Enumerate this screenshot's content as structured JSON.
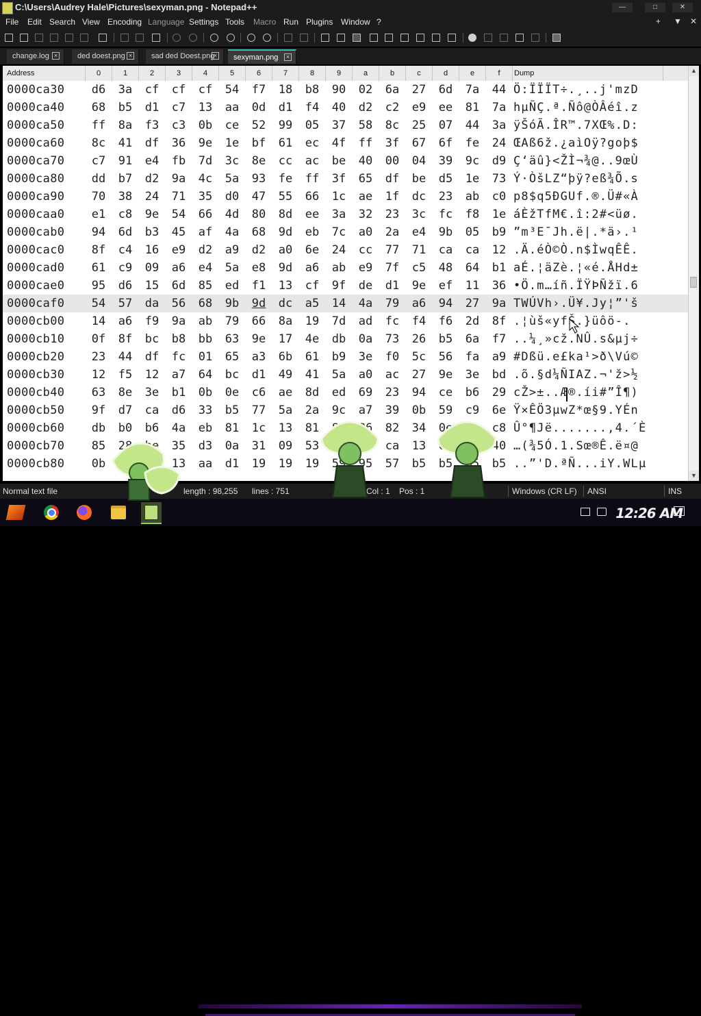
{
  "window": {
    "title": "C:\\Users\\Audrey Hale\\Pictures\\sexyman.png - Notepad++",
    "controls": [
      "—",
      "□",
      "✕"
    ]
  },
  "menu": {
    "items": [
      "File",
      "Edit",
      "Search",
      "View",
      "Encoding",
      "Language",
      "Settings",
      "Tools",
      "Macro",
      "Run",
      "Plugins",
      "Window",
      "?"
    ],
    "right_controls": [
      "+",
      "▼",
      "✕"
    ]
  },
  "tabs": [
    {
      "label": "change.log",
      "active": false
    },
    {
      "label": "ded doest.png",
      "active": false
    },
    {
      "label": "sad ded Doest.png",
      "active": false
    },
    {
      "label": "sexyman.png",
      "active": true
    }
  ],
  "hex_header": {
    "address": "Address",
    "columns": [
      "0",
      "1",
      "2",
      "3",
      "4",
      "5",
      "6",
      "7",
      "8",
      "9",
      "a",
      "b",
      "c",
      "d",
      "e",
      "f"
    ],
    "dump": "Dump"
  },
  "hex_rows": [
    {
      "addr": "0000ca30",
      "bytes": [
        "d6",
        "3a",
        "cf",
        "cf",
        "cf",
        "54",
        "f7",
        "18",
        "b8",
        "90",
        "02",
        "6a",
        "27",
        "6d",
        "7a",
        "44"
      ],
      "dump": "Ö:ÏÏÏT÷.¸..j'mzD"
    },
    {
      "addr": "0000ca40",
      "bytes": [
        "68",
        "b5",
        "d1",
        "c7",
        "13",
        "aa",
        "0d",
        "d1",
        "f4",
        "40",
        "d2",
        "c2",
        "e9",
        "ee",
        "81",
        "7a"
      ],
      "dump": "hµÑÇ.ª.Ñô@ÒÂéî.z"
    },
    {
      "addr": "0000ca50",
      "bytes": [
        "ff",
        "8a",
        "f3",
        "c3",
        "0b",
        "ce",
        "52",
        "99",
        "05",
        "37",
        "58",
        "8c",
        "25",
        "07",
        "44",
        "3a"
      ],
      "dump": "ÿŠóÃ.ÎR™.7XŒ%.D:"
    },
    {
      "addr": "0000ca60",
      "bytes": [
        "8c",
        "41",
        "df",
        "36",
        "9e",
        "1e",
        "bf",
        "61",
        "ec",
        "4f",
        "ff",
        "3f",
        "67",
        "6f",
        "fe",
        "24"
      ],
      "dump": "ŒAß6ž.¿aìOÿ?goþ$"
    },
    {
      "addr": "0000ca70",
      "bytes": [
        "c7",
        "91",
        "e4",
        "fb",
        "7d",
        "3c",
        "8e",
        "cc",
        "ac",
        "be",
        "40",
        "00",
        "04",
        "39",
        "9c",
        "d9"
      ],
      "dump": "Ç‘äû}<ŽÌ¬¾@..9œÙ"
    },
    {
      "addr": "0000ca80",
      "bytes": [
        "dd",
        "b7",
        "d2",
        "9a",
        "4c",
        "5a",
        "93",
        "fe",
        "ff",
        "3f",
        "65",
        "df",
        "be",
        "d5",
        "1e",
        "73"
      ],
      "dump": "Ý·ÒšLZ“þÿ?eß¾Õ.s"
    },
    {
      "addr": "0000ca90",
      "bytes": [
        "70",
        "38",
        "24",
        "71",
        "35",
        "d0",
        "47",
        "55",
        "66",
        "1c",
        "ae",
        "1f",
        "dc",
        "23",
        "ab",
        "c0"
      ],
      "dump": "p8$q5ÐGUf.®.Ü#«À"
    },
    {
      "addr": "0000caa0",
      "bytes": [
        "e1",
        "c8",
        "9e",
        "54",
        "66",
        "4d",
        "80",
        "8d",
        "ee",
        "3a",
        "32",
        "23",
        "3c",
        "fc",
        "f8",
        "1e"
      ],
      "dump": "áÈžTfM€.î:2#<üø."
    },
    {
      "addr": "0000cab0",
      "bytes": [
        "94",
        "6d",
        "b3",
        "45",
        "af",
        "4a",
        "68",
        "9d",
        "eb",
        "7c",
        "a0",
        "2a",
        "e4",
        "9b",
        "05",
        "b9"
      ],
      "dump": "”m³E¯Jh.ë|.*ä›.¹"
    },
    {
      "addr": "0000cac0",
      "bytes": [
        "8f",
        "c4",
        "16",
        "e9",
        "d2",
        "a9",
        "d2",
        "a0",
        "6e",
        "24",
        "cc",
        "77",
        "71",
        "ca",
        "ca",
        "12"
      ],
      "dump": ".Ä.éÒ©Ò.n$ÌwqÊÊ."
    },
    {
      "addr": "0000cad0",
      "bytes": [
        "61",
        "c9",
        "09",
        "a6",
        "e4",
        "5a",
        "e8",
        "9d",
        "a6",
        "ab",
        "e9",
        "7f",
        "c5",
        "48",
        "64",
        "b1"
      ],
      "dump": "aÉ.¦äZè.¦«é.ÅHd±"
    },
    {
      "addr": "0000cae0",
      "bytes": [
        "95",
        "d6",
        "15",
        "6d",
        "85",
        "ed",
        "f1",
        "13",
        "cf",
        "9f",
        "de",
        "d1",
        "9e",
        "ef",
        "11",
        "36"
      ],
      "dump": "•Ö.m…íñ.ÏŸÞÑžï.6"
    },
    {
      "addr": "0000caf0",
      "bytes": [
        "54",
        "57",
        "da",
        "56",
        "68",
        "9b",
        "9d",
        "dc",
        "a5",
        "14",
        "4a",
        "79",
        "a6",
        "94",
        "27",
        "9a"
      ],
      "dump": "TWÚVh›.Ü¥.Jy¦”'š",
      "selected": true,
      "underline_index": 6
    },
    {
      "addr": "0000cb00",
      "bytes": [
        "14",
        "a6",
        "f9",
        "9a",
        "ab",
        "79",
        "66",
        "8a",
        "19",
        "7d",
        "ad",
        "fc",
        "f4",
        "f6",
        "2d",
        "8f"
      ],
      "dump": ".¦ùš«yfŠ.}­üôö-."
    },
    {
      "addr": "0000cb10",
      "bytes": [
        "0f",
        "8f",
        "bc",
        "b8",
        "bb",
        "63",
        "9e",
        "17",
        "4e",
        "db",
        "0a",
        "73",
        "26",
        "b5",
        "6a",
        "f7"
      ],
      "dump": "..¼¸»cž.NÛ.s&µj÷"
    },
    {
      "addr": "0000cb20",
      "bytes": [
        "23",
        "44",
        "df",
        "fc",
        "01",
        "65",
        "a3",
        "6b",
        "61",
        "b9",
        "3e",
        "f0",
        "5c",
        "56",
        "fa",
        "a9"
      ],
      "dump": "#Dßü.e£ka¹>ð\\Vú©"
    },
    {
      "addr": "0000cb30",
      "bytes": [
        "12",
        "f5",
        "12",
        "a7",
        "64",
        "bc",
        "d1",
        "49",
        "41",
        "5a",
        "a0",
        "ac",
        "27",
        "9e",
        "3e",
        "bd"
      ],
      "dump": ".õ.§d¼ÑIAZ.¬'ž>½"
    },
    {
      "addr": "0000cb40",
      "bytes": [
        "63",
        "8e",
        "3e",
        "b1",
        "0b",
        "0e",
        "c6",
        "ae",
        "8d",
        "ed",
        "69",
        "23",
        "94",
        "ce",
        "b6",
        "29"
      ],
      "dump": "cŽ>±..Æ®.íi#”Î¶)"
    },
    {
      "addr": "0000cb50",
      "bytes": [
        "9f",
        "d7",
        "ca",
        "d6",
        "33",
        "b5",
        "77",
        "5a",
        "2a",
        "9c",
        "a7",
        "39",
        "0b",
        "59",
        "c9",
        "6e"
      ],
      "dump": "Ÿ×ÊÖ3µwZ*œ§9.YÉn"
    },
    {
      "addr": "0000cb60",
      "bytes": [
        "db",
        "b0",
        "b6",
        "4a",
        "eb",
        "81",
        "1c",
        "13",
        "81",
        "86",
        "86",
        "82",
        "34",
        "0e",
        "b4",
        "c8"
      ],
      "dump": "Û°¶Jë.......‚4.´È"
    },
    {
      "addr": "0000cb70",
      "bytes": [
        "85",
        "28",
        "be",
        "35",
        "d3",
        "0a",
        "31",
        "09",
        "53",
        "9c",
        "ae",
        "ca",
        "13",
        "eb",
        "a4",
        "40"
      ],
      "dump": "…(¾5Ó.1.Sœ®Ê.ë¤@"
    },
    {
      "addr": "0000cb80",
      "bytes": [
        "0b",
        "8b",
        "44",
        "13",
        "aa",
        "d1",
        "19",
        "19",
        "19",
        "59",
        "95",
        "57",
        "b5",
        "b5",
        "b5",
        "b5"
      ],
      "dump": "..”'D.ªÑ...iY.WLµ"
    }
  ],
  "status": {
    "file_type": "Normal text file",
    "length": "length : 98,255",
    "lines": "lines : 751",
    "col": "Col : 1",
    "pos": "Pos : 1",
    "eol": "Windows (CR LF)",
    "encoding": "ANSI",
    "mode": "INS"
  },
  "taskbar": {
    "clock": "12:26 AM"
  },
  "colors": {
    "chrome_bg": "#1c1c1c",
    "tab_active_accent": "#3fb9c4",
    "hex_bg": "#ffffff",
    "selected_row": "#e6e6e6",
    "taskbar_bg": "#0c0a14",
    "neon": "#7a2bd0"
  },
  "icons": {
    "toolbar": [
      "new-file-icon",
      "open-file-icon",
      "save-icon",
      "save-all-icon",
      "close-icon",
      "close-all-icon",
      "print-icon",
      "cut-icon",
      "copy-icon",
      "paste-icon",
      "undo-icon",
      "redo-icon",
      "find-icon",
      "replace-icon",
      "zoom-in-icon",
      "zoom-out-icon",
      "sync-v-icon",
      "sync-h-icon",
      "word-wrap-icon",
      "show-all-chars-icon",
      "indent-guide-icon",
      "udl-icon",
      "doc-map-icon",
      "doc-list-icon",
      "function-list-icon",
      "folder-workspace-icon",
      "monitor-icon",
      "macro-record-icon",
      "macro-stop-icon",
      "macro-play-icon",
      "macro-play-multiple-icon",
      "macro-save-icon",
      "hex-editor-icon"
    ],
    "tray": [
      "network-icon",
      "volume-icon",
      "notifications-icon"
    ]
  }
}
